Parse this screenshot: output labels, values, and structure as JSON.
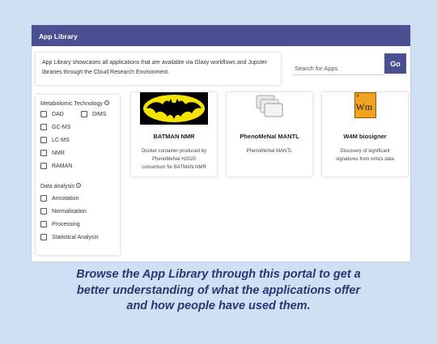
{
  "header": {
    "title": "App Library"
  },
  "intro": {
    "text": "App Library showcases all applications that are available via Glaxy workflows and Juputer libraries through the Cloud Research Environment."
  },
  "search": {
    "placeholder": "Search for Apps",
    "go_label": "Go"
  },
  "filters": {
    "metabolomic": {
      "title": "Metabolomic Technology",
      "help": "?",
      "options": [
        "DAD",
        "DIMS",
        "GC-MS",
        "LC-MS",
        "NMR",
        "RAMAN"
      ]
    },
    "analysis": {
      "title": "Data analysis",
      "help": "?",
      "options": [
        "Annotation",
        "Normalisation",
        "Processing",
        "Statistical Analysis"
      ]
    }
  },
  "apps": [
    {
      "title": "BATMAN NMR",
      "description": "Docker container produced by PhenoMeNal H2020 consortium for BATMAN NMR",
      "icon": "batman-logo-icon"
    },
    {
      "title": "PhenoMeNal MANTL",
      "description": "PhenoMeNal MANTL",
      "icon": "stacked-windows-icon"
    },
    {
      "title": "W4M biosigner",
      "description": "Discovery of significant signatures from omics data",
      "icon": "w4m-element-tile-icon",
      "logo": {
        "mass_number": "4",
        "symbol": "Wm"
      }
    }
  ],
  "caption": {
    "lines": [
      "Browse the App Library through this portal to get a",
      "better understanding of what the applications offer",
      "and how people have used them."
    ]
  },
  "colors": {
    "header": "#4a4f92",
    "background": "#cfe0f5",
    "caption": "#2d3570",
    "w4m_tile": "#f0a21e"
  }
}
